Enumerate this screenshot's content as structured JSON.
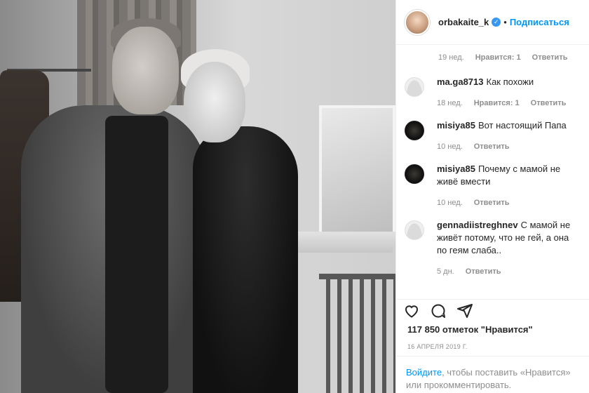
{
  "post": {
    "username": "orbakaite_k",
    "follow_label": "Подписаться",
    "separator": "•"
  },
  "comments_area": {
    "first_meta": {
      "time": "19 нед.",
      "likes": "Нравится: 1",
      "reply": "Ответить"
    },
    "comments": [
      {
        "user": "ma.ga8713",
        "text": "Как похожи",
        "time": "18 нед.",
        "likes": "Нравится: 1",
        "reply": "Ответить",
        "avatar": "default"
      },
      {
        "user": "misiya85",
        "text": "Вот настоящий Папа",
        "time": "10 нед.",
        "reply": "Ответить",
        "avatar": "dark"
      },
      {
        "user": "misiya85",
        "text": "Почему с мамой не живё вмести",
        "time": "10 нед.",
        "reply": "Ответить",
        "avatar": "dark"
      },
      {
        "user": "gennadiistreghnev",
        "text": "С мамой не живёт потому, что не гей, а она по геям слаба..",
        "time": "5 дн.",
        "reply": "Ответить",
        "avatar": "default"
      }
    ]
  },
  "actions": {
    "like_icon": "heart-icon",
    "comment_icon": "comment-icon",
    "share_icon": "share-icon"
  },
  "likes_text": "117 850 отметок \"Нравится\"",
  "date_text": "16 АПРЕЛЯ 2019 Г.",
  "login": {
    "link": "Войдите",
    "rest": ", чтобы поставить «Нравится» или прокомментировать."
  },
  "colors": {
    "accent": "#0095f6",
    "muted": "#8e8e8e",
    "text": "#262626"
  }
}
